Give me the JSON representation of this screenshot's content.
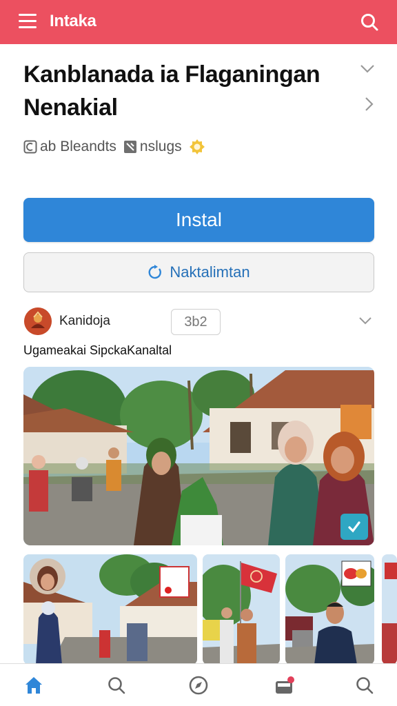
{
  "header": {
    "title": "Intaka",
    "menu_icon": "hamburger-menu-icon",
    "search_icon": "search-icon",
    "color": "#ec5060"
  },
  "app": {
    "title": "Kanblanada ia Flaganingan Nenakial",
    "meta_1": "ab Bleandts",
    "meta_2": "nslugs"
  },
  "actions": {
    "install_label": "Instal",
    "secondary_label": "Naktalimtan",
    "install_color": "#2f86d8"
  },
  "developer": {
    "name": "Kanidoja",
    "badge": "3b2",
    "description": "Ugameakai SipckaKanaltal"
  },
  "nav": {
    "items": [
      "home-icon",
      "search-icon",
      "compass-icon",
      "inbox-icon",
      "search-icon"
    ]
  }
}
